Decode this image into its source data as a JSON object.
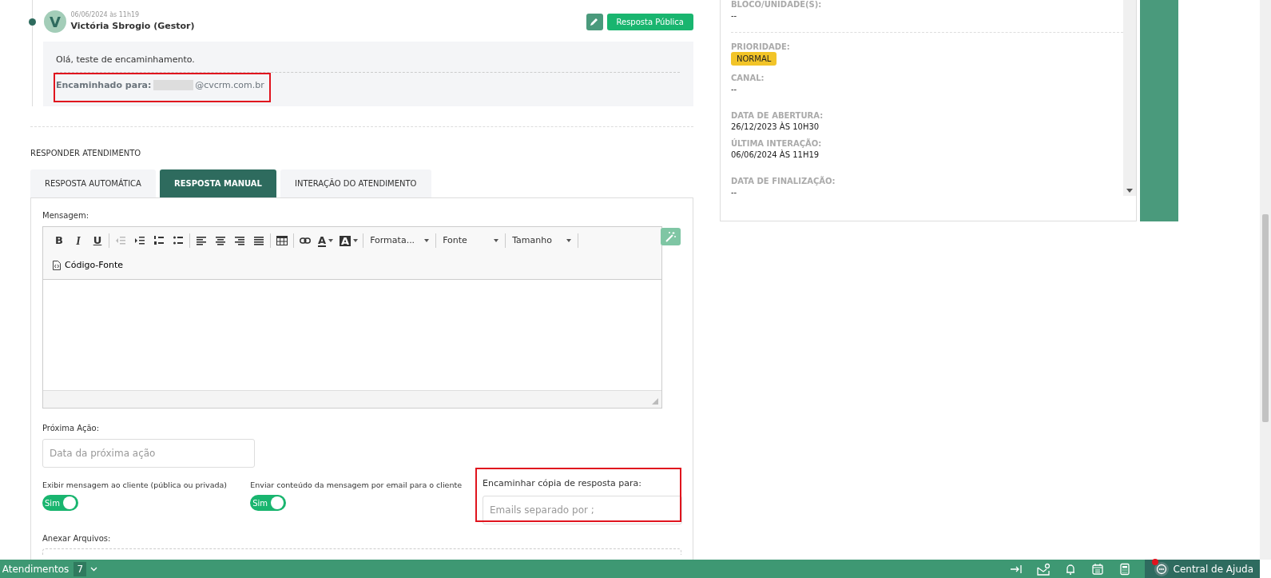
{
  "message": {
    "avatar_letter": "V",
    "date": "06/06/2024 às 11h19",
    "author": "Victória Sbrogio (Gestor)",
    "reply_button": "Resposta Pública",
    "body": "Olá, teste de encaminhamento.",
    "forwarded_label": "Encaminhado para:",
    "forwarded_email": "@cvcrm.com.br"
  },
  "reply_section": {
    "title": "RESPONDER ATENDIMENTO",
    "tabs": [
      {
        "label": "RESPOSTA AUTOMÁTICA",
        "selected": false
      },
      {
        "label": "RESPOSTA MANUAL",
        "selected": true
      },
      {
        "label": "INTERAÇÃO DO ATENDIMENTO",
        "selected": false
      }
    ],
    "message_label": "Mensagem:",
    "toolbar": [
      {
        "kind": "bold",
        "label": "B",
        "disabled": false
      },
      {
        "kind": "italic",
        "label": "I",
        "disabled": false
      },
      {
        "kind": "underline",
        "label": "U",
        "disabled": false
      },
      {
        "kind": "separator"
      },
      {
        "kind": "outdent",
        "disabled": true
      },
      {
        "kind": "indent",
        "disabled": false
      },
      {
        "kind": "ordered-list",
        "disabled": false
      },
      {
        "kind": "bullet-list",
        "disabled": false
      },
      {
        "kind": "separator"
      },
      {
        "kind": "align-left",
        "disabled": false
      },
      {
        "kind": "align-center",
        "disabled": false
      },
      {
        "kind": "align-right",
        "disabled": false
      },
      {
        "kind": "justify",
        "disabled": false
      },
      {
        "kind": "separator"
      },
      {
        "kind": "table",
        "disabled": false
      },
      {
        "kind": "separator"
      },
      {
        "kind": "link",
        "disabled": false
      },
      {
        "kind": "text-color",
        "label": "A",
        "disabled": false
      },
      {
        "kind": "background-color",
        "label": "A",
        "disabled": false
      },
      {
        "kind": "separator"
      },
      {
        "kind": "dropdown",
        "label": "Formata..."
      },
      {
        "kind": "separator"
      },
      {
        "kind": "dropdown",
        "label": "Fonte"
      },
      {
        "kind": "separator"
      },
      {
        "kind": "dropdown",
        "label": "Tamanho"
      },
      {
        "kind": "separator"
      }
    ],
    "source_button": "Código-Fonte",
    "next_action": {
      "label": "Próxima Ação:",
      "placeholder": "Data da próxima ação"
    },
    "toggles": [
      {
        "label": "Exibir mensagem ao cliente (pública ou privada)",
        "text": "Sim",
        "on": true
      },
      {
        "label": "Enviar conteúdo da mensagem por email para o cliente",
        "text": "Sim",
        "on": true
      }
    ],
    "forward": {
      "label": "Encaminhar cópia de resposta para:",
      "placeholder": "Emails separado por ;"
    },
    "attach_label": "Anexar Arquivos:"
  },
  "details": [
    {
      "label": "BLOCO/UNIDADE(S):",
      "value": "--",
      "kind": "text"
    },
    {
      "label": "PRIORIDADE:",
      "value": "NORMAL",
      "kind": "badge",
      "color": "#f2c428"
    },
    {
      "label": "CANAL:",
      "value": "--",
      "kind": "text"
    },
    {
      "label": "DATA DE ABERTURA:",
      "value": "26/12/2023 ÀS 10H30",
      "kind": "text"
    },
    {
      "label": "ÚLTIMA INTERAÇÃO:",
      "value": "06/06/2024 ÀS 11H19",
      "kind": "text"
    },
    {
      "label": "DATA DE FINALIZAÇÃO:",
      "value": "--",
      "kind": "text"
    }
  ],
  "bottom_bar": {
    "label": "Atendimentos",
    "count": "7",
    "help": "Central de Ajuda",
    "notification": true
  }
}
